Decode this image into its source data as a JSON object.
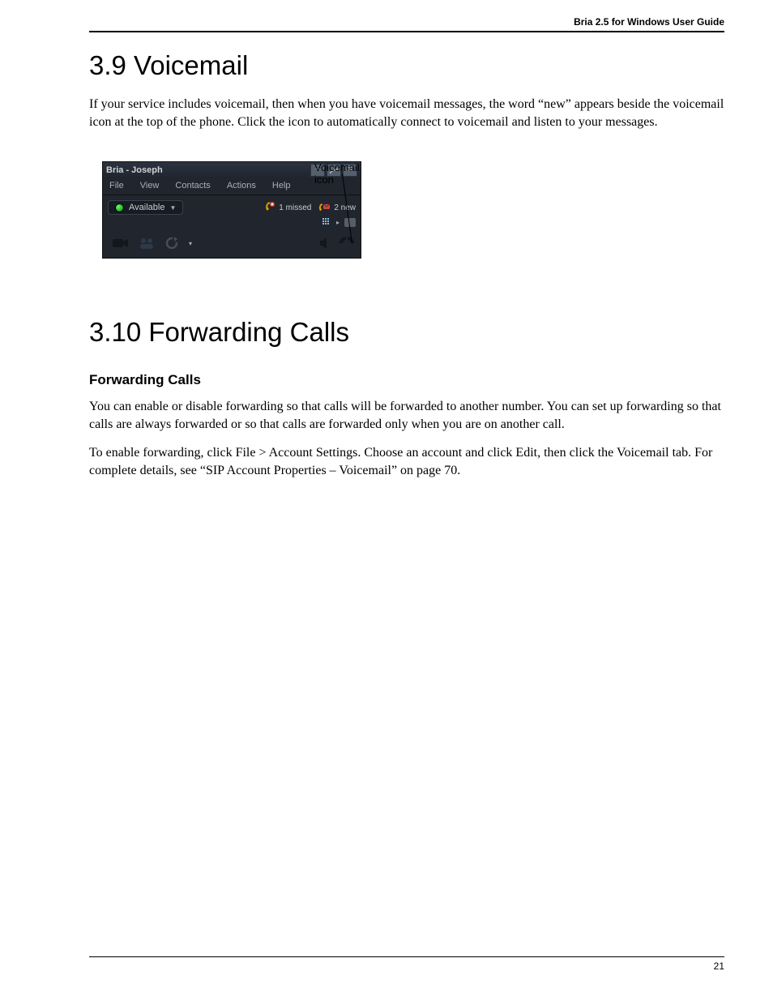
{
  "header": {
    "guide_title": "Bria 2.5 for Windows User Guide"
  },
  "section_voicemail": {
    "heading": "3.9 Voicemail",
    "body": "If your service includes voicemail, then when you have voicemail messages, the word “new” appears beside the voicemail icon at the top of the phone. Click the icon to automatically connect to voicemail and listen to your messages."
  },
  "figure": {
    "callout": "Voicemail icon",
    "app": {
      "title": "Bria - Joseph",
      "menu": [
        "File",
        "View",
        "Contacts",
        "Actions",
        "Help"
      ],
      "presence": "Available",
      "missed_text": "1 missed",
      "new_text": "2 new"
    }
  },
  "section_forwarding": {
    "heading": "3.10 Forwarding Calls",
    "subheading": "Forwarding Calls",
    "body1": "You can enable or disable forwarding so that calls will be forwarded to another number. You can set up forwarding so that calls are always forwarded or so that calls are forwarded only when you are on another call.",
    "body2": "To enable forwarding, click File > Account Settings. Choose an account and click Edit, then click the Voicemail tab. For complete details, see “SIP Account Properties – Voicemail” on page 70."
  },
  "footer": {
    "page_number": "21"
  }
}
